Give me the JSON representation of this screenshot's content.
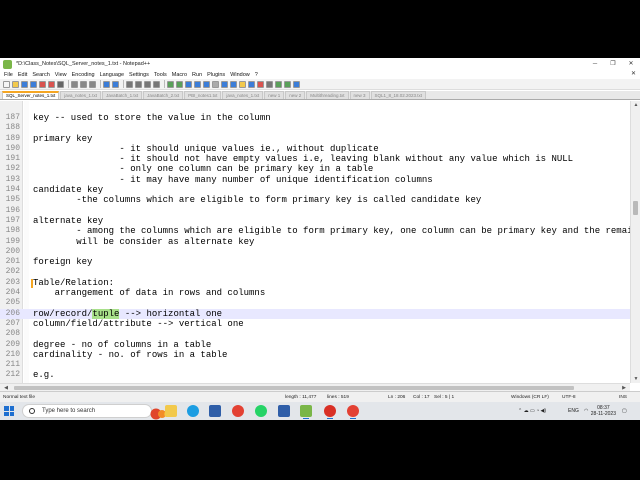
{
  "window": {
    "title": "*D:\\Class_Notes\\SQL_Server_notes_1.txt - Notepad++",
    "controls": {
      "minimize": "─",
      "maximize": "❐",
      "close": "✕"
    }
  },
  "menu": {
    "items": [
      "File",
      "Edit",
      "Search",
      "View",
      "Encoding",
      "Language",
      "Settings",
      "Tools",
      "Macro",
      "Run",
      "Plugins",
      "Window",
      "?"
    ],
    "right": "✕"
  },
  "toolbar": {
    "icons": [
      "new-icon",
      "open-icon",
      "save-icon",
      "save-all-icon",
      "close-icon",
      "close-all-icon",
      "print-icon",
      "cut-icon",
      "copy-icon",
      "paste-icon",
      "undo-icon",
      "redo-icon",
      "find-icon",
      "replace-icon",
      "zoom-in-icon",
      "zoom-out-icon",
      "sync-v-icon",
      "sync-h-icon",
      "wrap-icon",
      "all-chars-icon",
      "indent-guide-icon",
      "lang-icon",
      "doc-map-icon",
      "func-list-icon",
      "folder-icon",
      "monitor-icon",
      "record-icon",
      "stop-icon",
      "play-icon",
      "play-multi-icon",
      "save-macro-icon"
    ]
  },
  "tabs": [
    {
      "label": "SQL_Server_notes_1.txt",
      "active": true
    },
    {
      "label": "java_notes_1.txt",
      "active": false
    },
    {
      "label": "JavaBatch_1.txt",
      "active": false
    },
    {
      "label": "JavaBatch_2.txt",
      "active": false
    },
    {
      "label": "PBI_notes1.txt",
      "active": false
    },
    {
      "label": "java_notes_1.txt",
      "active": false
    },
    {
      "label": "new 1",
      "active": false
    },
    {
      "label": "new 2",
      "active": false
    },
    {
      "label": "Multithreading.txt",
      "active": false
    },
    {
      "label": "new 3",
      "active": false
    },
    {
      "label": "SQL1_8_18.02.2023.txt",
      "active": false
    }
  ],
  "editor": {
    "current_line": 206,
    "lines": [
      {
        "n": "187",
        "text": "key -- used to store the value in the column"
      },
      {
        "n": "188",
        "text": ""
      },
      {
        "n": "189",
        "text": "primary key"
      },
      {
        "n": "190",
        "text": "                - it should unique values ie., without duplicate"
      },
      {
        "n": "191",
        "text": "                - it should not have empty values i.e, leaving blank without any value which is NULL"
      },
      {
        "n": "192",
        "text": "                - only one column can be primary key in a table"
      },
      {
        "n": "193",
        "text": "                - it may have many number of unique identification columns"
      },
      {
        "n": "194",
        "text": "candidate key"
      },
      {
        "n": "195",
        "text": "        -the columns which are eligible to form primary key is called candidate key"
      },
      {
        "n": "196",
        "text": ""
      },
      {
        "n": "197",
        "text": "alternate key"
      },
      {
        "n": "198",
        "text": "        - among the columns which are eligible to form primary key, one column can be primary key and the remaining"
      },
      {
        "n": "199",
        "text": "        will be consider as alternate key"
      },
      {
        "n": "200",
        "text": ""
      },
      {
        "n": "201",
        "text": "foreign key"
      },
      {
        "n": "202",
        "text": ""
      },
      {
        "n": "203",
        "text": "Table/Relation:"
      },
      {
        "n": "204",
        "text": "    arrangement of data in rows and columns"
      },
      {
        "n": "205",
        "text": ""
      },
      {
        "n": "206",
        "pre": "row/record/",
        "hl": "tuple",
        "post": " --> horizontal one"
      },
      {
        "n": "207",
        "text": "column/field/attribute --> vertical one"
      },
      {
        "n": "208",
        "text": ""
      },
      {
        "n": "209",
        "text": "degree - no of columns in a table"
      },
      {
        "n": "210",
        "text": "cardinality - no. of rows in a table"
      },
      {
        "n": "211",
        "text": ""
      },
      {
        "n": "212",
        "text": "e.g."
      }
    ]
  },
  "status": {
    "type": "Normal text file",
    "length": "length : 11,477",
    "lines": "lines : 519",
    "position": "Ln : 206",
    "col": "Col : 17",
    "sel": "Sel : 5 | 1",
    "eol": "Windows (CR LF)",
    "encoding": "UTF-8",
    "mode": "INS"
  },
  "taskbar": {
    "search_placeholder": "Type here to search",
    "tray_lang": "ENG",
    "time": "08:37",
    "date": "28-11-2023"
  },
  "colors": {
    "highlight": "#a8e08a",
    "current_line": "#e8e8ff",
    "active_tab_accent": "#f5a623"
  }
}
